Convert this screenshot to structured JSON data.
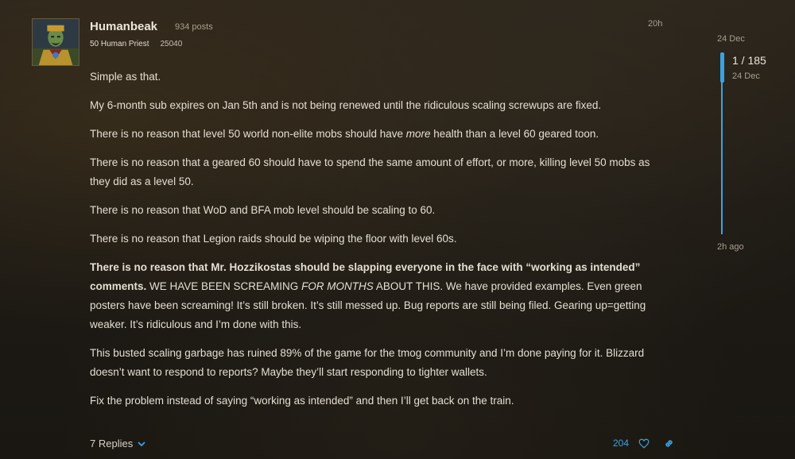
{
  "post": {
    "author": "Humanbeak",
    "post_count": "934 posts",
    "character": "50 Human Priest",
    "score": "25040",
    "time": "20h",
    "paragraphs": {
      "p1": "Simple as that.",
      "p2": "My 6-month sub expires on Jan 5th and is not being renewed until the ridiculous scaling screwups are fixed.",
      "p3_a": "There is no reason that level 50 world non-elite mobs should have ",
      "p3_em": "more",
      "p3_b": " health than a level 60 geared toon.",
      "p4": "There is no reason that a geared 60 should have to spend the same amount of effort, or more, killing level 50 mobs as they did as a level 50.",
      "p5": "There is no reason that WoD and BFA mob level should be scaling to 60.",
      "p6": "There is no reason that Legion raids should be wiping the floor with level 60s.",
      "p7_bold": "There is no reason that Mr. Hozzikostas should be slapping everyone in the face with “working as intended” comments.",
      "p7_a": " WE HAVE BEEN SCREAMING ",
      "p7_em": "FOR MONTHS",
      "p7_b": " ABOUT THIS. We have provided examples. Even green posters have been screaming! It’s still broken. It’s still messed up. Bug reports are still being filed. Gearing up=getting weaker. It’s ridiculous and I’m done with this.",
      "p8": "This busted scaling garbage has ruined 89% of the game for the tmog community and I’m done paying for it. Blizzard doesn’t want to respond to reports? Maybe they’ll start responding to tighter wallets.",
      "p9": "Fix the problem instead of saying “working as intended” and then I’ll get back on the train."
    }
  },
  "footer": {
    "replies_label": "7 Replies",
    "likes": "204",
    "icons": {
      "replies": "chevron-down-icon",
      "like": "heart-icon",
      "share": "link-icon"
    }
  },
  "timeline": {
    "top_date": "24 Dec",
    "position": "1 / 185",
    "position_date": "24 Dec",
    "bottom_label": "2h ago"
  },
  "colors": {
    "accent": "#3aa3e3",
    "text": "#e4ded2",
    "muted": "#a89f90"
  }
}
